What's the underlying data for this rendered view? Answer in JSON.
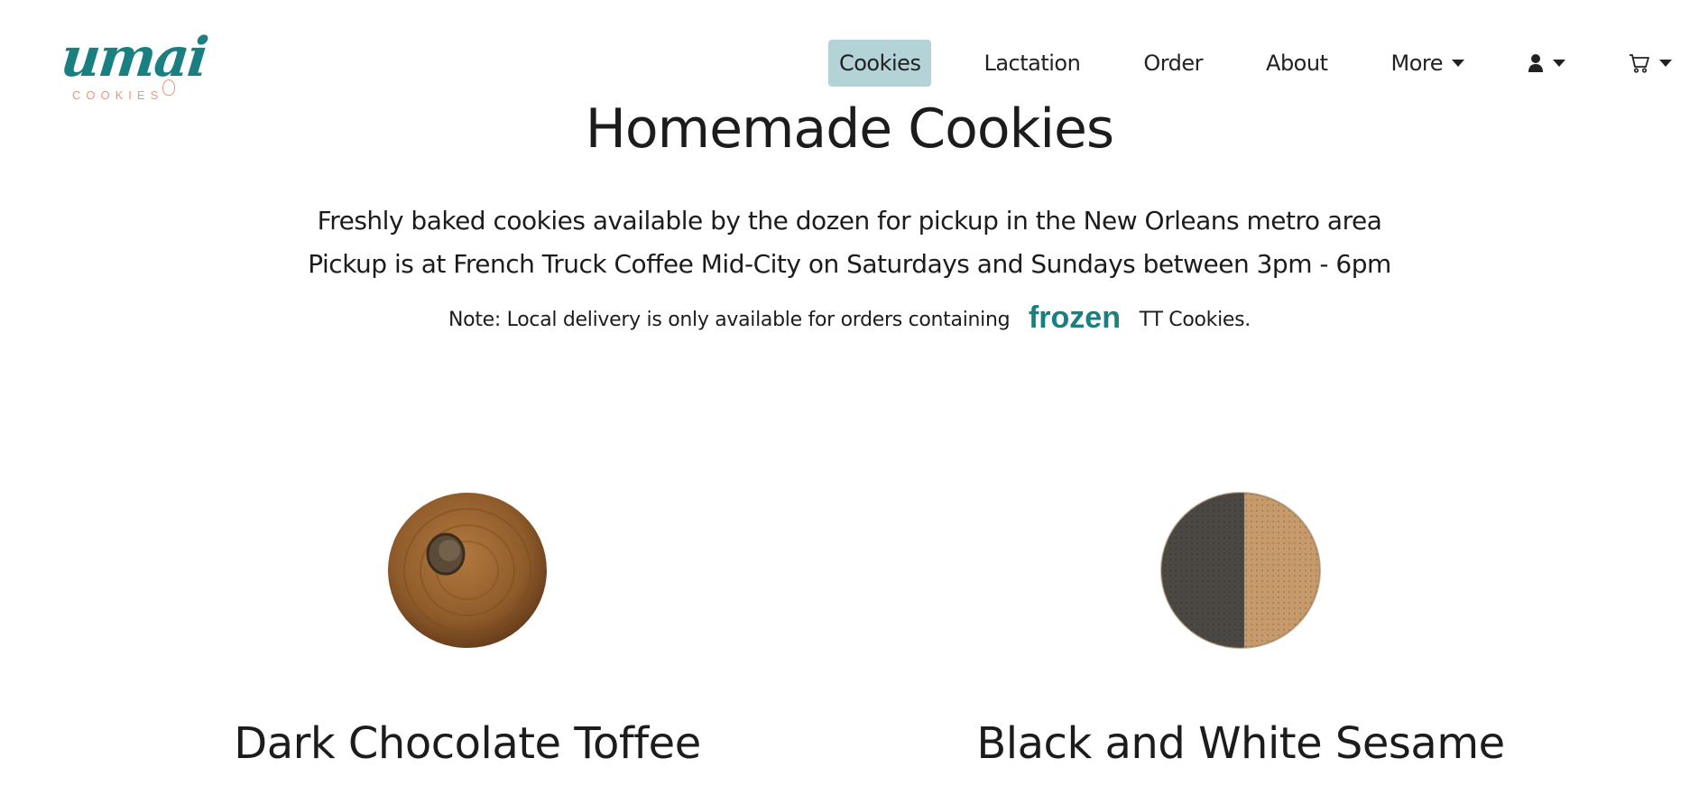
{
  "logo": {
    "wordmark": "umai",
    "sub": "COOKIES"
  },
  "nav": {
    "items": [
      {
        "label": "Cookies",
        "active": true
      },
      {
        "label": "Lactation",
        "active": false
      },
      {
        "label": "Order",
        "active": false
      },
      {
        "label": "About",
        "active": false
      },
      {
        "label": "More",
        "active": false,
        "dropdown": true
      }
    ],
    "account_icon": "user-icon",
    "cart_icon": "cart-icon"
  },
  "hero": {
    "title": "Homemade Cookies",
    "line1": "Freshly baked cookies available by the dozen for pickup in the New Orleans metro area",
    "line2": "Pickup is at French Truck Coffee Mid-City on Saturdays and Sundays between 3pm - 6pm",
    "note_prefix": "Note: Local delivery is only available for orders containing",
    "note_highlight": "frozen",
    "note_suffix": "TT Cookies."
  },
  "products": [
    {
      "name": "Dark Chocolate Toffee",
      "image": "dark-chocolate-toffee-cookie"
    },
    {
      "name": "Black and White Sesame",
      "image": "black-and-white-sesame-cookie"
    }
  ],
  "colors": {
    "brand_teal": "#1a7f80",
    "active_nav_bg": "#b3d3d6",
    "logo_accent": "#e9967a"
  }
}
